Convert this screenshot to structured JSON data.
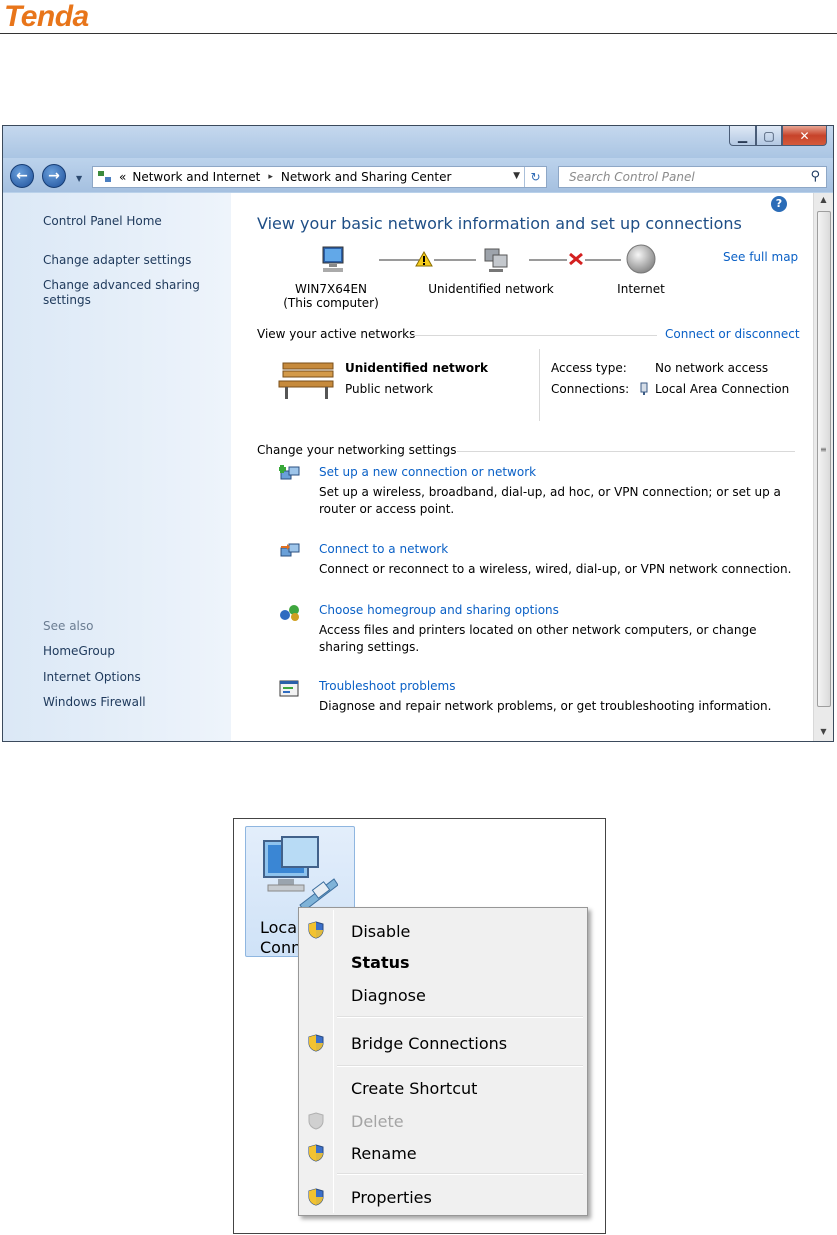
{
  "brand": {
    "logo_text": "Tenda"
  },
  "window": {
    "address": {
      "prefix": "«",
      "crumbs": [
        "Network and Internet",
        "Network and Sharing Center"
      ],
      "separator": "▸"
    },
    "search_placeholder": "Search Control Panel",
    "sidebar": {
      "home": "Control Panel Home",
      "adapter": "Change adapter settings",
      "advanced_line1": "Change advanced sharing",
      "advanced_line2": "settings",
      "see_also": "See also",
      "homegroup": "HomeGroup",
      "internet_options": "Internet Options",
      "firewall": "Windows Firewall"
    },
    "main": {
      "title": "View your basic network information and set up connections",
      "see_full_map": "See full map",
      "map": {
        "computer_name": "WIN7X64EN",
        "computer_sub": "(This computer)",
        "network": "Unidentified network",
        "internet": "Internet"
      },
      "active_networks_label": "View your active networks",
      "connect_disconnect": "Connect or disconnect",
      "active": {
        "name": "Unidentified network",
        "type": "Public network",
        "access_key": "Access type:",
        "access_val": "No network access",
        "connections_key": "Connections:",
        "connections_val": "Local Area Connection"
      },
      "change_settings_label": "Change your networking settings",
      "tasks": [
        {
          "link": "Set up a new connection or network",
          "desc": "Set up a wireless, broadband, dial-up, ad hoc, or VPN connection; or set up a router or access point."
        },
        {
          "link": "Connect to a network",
          "desc": "Connect or reconnect to a wireless, wired, dial-up, or VPN network connection."
        },
        {
          "link": "Choose homegroup and sharing options",
          "desc": "Access files and printers located on other network computers, or change sharing settings."
        },
        {
          "link": "Troubleshoot problems",
          "desc": "Diagnose and repair network problems, or get troubleshooting information."
        }
      ]
    }
  },
  "explorer": {
    "item_label_line1": "Local A",
    "item_label_line2": "Conn",
    "menu": {
      "disable": "Disable",
      "status": "Status",
      "diagnose": "Diagnose",
      "bridge": "Bridge Connections",
      "shortcut": "Create Shortcut",
      "delete": "Delete",
      "rename": "Rename",
      "properties": "Properties"
    }
  },
  "colors": {
    "link": "#0a60c6",
    "title": "#1e4e86",
    "logo": "#e8751a"
  }
}
